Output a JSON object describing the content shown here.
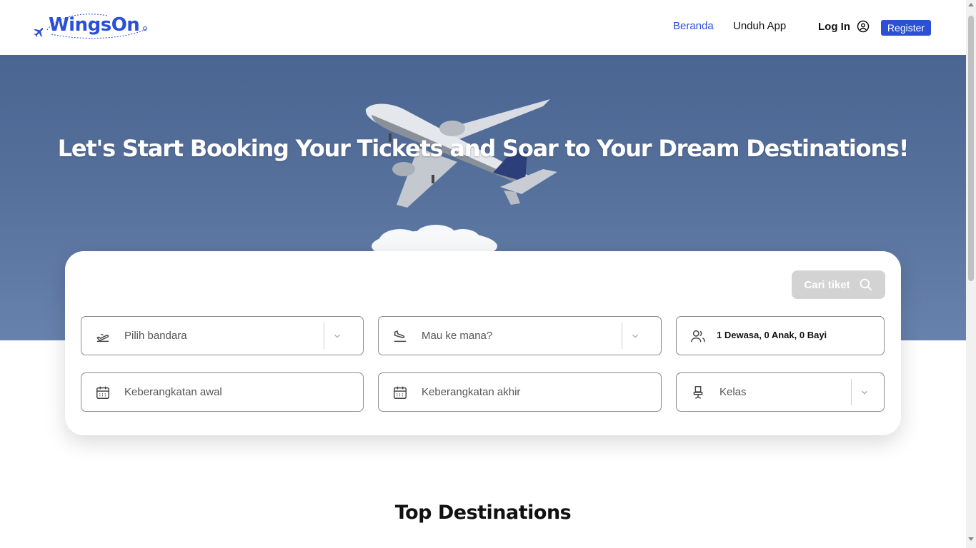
{
  "brand": {
    "name": "WingsOn",
    "primary_color": "#2b4fd6"
  },
  "nav": {
    "beranda": "Beranda",
    "unduh": "Unduh App",
    "login": "Log In",
    "register": "Register"
  },
  "hero": {
    "title": "Let's Start Booking Your Tickets and Soar to Your Dream Destinations!"
  },
  "search": {
    "button_label": "Cari tiket",
    "from_placeholder": "Pilih bandara",
    "to_placeholder": "Mau ke mana?",
    "passengers_value": "1 Dewasa, 0 Anak, 0 Bayi",
    "depart_start_placeholder": "Keberangkatan awal",
    "depart_end_placeholder": "Keberangkatan akhir",
    "class_placeholder": "Kelas"
  },
  "sections": {
    "top_destinations": "Top Destinations"
  },
  "icons": {
    "logo_plane": "plane-icon",
    "login": "user-circle-icon",
    "search": "search-icon",
    "from": "takeoff-icon",
    "to": "landing-icon",
    "passengers": "users-icon",
    "calendar": "calendar-icon",
    "seat": "seat-icon",
    "dropdown": "chevron-down-icon"
  }
}
